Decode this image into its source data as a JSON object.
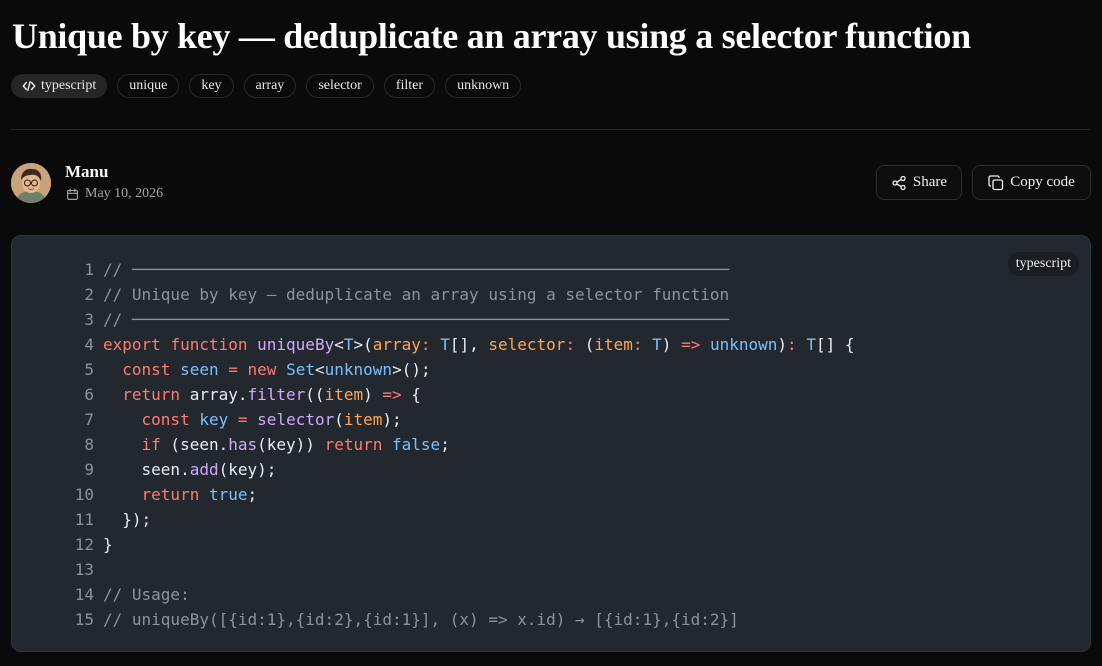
{
  "page": {
    "title": "Unique by key — deduplicate an array using a selector function"
  },
  "tags": [
    {
      "label": "typescript",
      "icon": "code-icon"
    },
    {
      "label": "unique"
    },
    {
      "label": "key"
    },
    {
      "label": "array"
    },
    {
      "label": "selector"
    },
    {
      "label": "filter"
    },
    {
      "label": "unknown"
    }
  ],
  "author": {
    "name": "Manu",
    "date": "May 10, 2026",
    "avatar_icon": "avatar-portrait"
  },
  "actions": {
    "share_label": "Share",
    "copy_label": "Copy code"
  },
  "code": {
    "language": "typescript",
    "line_numbers": [
      "1",
      "2",
      "3",
      "4",
      "5",
      "6",
      "7",
      "8",
      "9",
      "10",
      "11",
      "12",
      "13",
      "14",
      "15"
    ],
    "lines": [
      "// ──────────────────────────────────────────────────────────────",
      "// Unique by key — deduplicate an array using a selector function",
      "// ──────────────────────────────────────────────────────────────",
      "export function uniqueBy<T>(array: T[], selector: (item: T) => unknown): T[] {",
      "  const seen = new Set<unknown>();",
      "  return array.filter((item) => {",
      "    const key = selector(item);",
      "    if (seen.has(key)) return false;",
      "    seen.add(key);",
      "    return true;",
      "  });",
      "}",
      "",
      "// Usage:",
      "// uniqueBy([{id:1},{id:2},{id:1}], (x) => x.id) → [{id:1},{id:2}]"
    ]
  },
  "colors": {
    "background": "#0a0a0a",
    "code_background": "#23272e",
    "keyword": "#ff7b72",
    "function": "#d2a8ff",
    "type": "#79c0ff",
    "param": "#ffa657",
    "comment": "#8b949e"
  }
}
